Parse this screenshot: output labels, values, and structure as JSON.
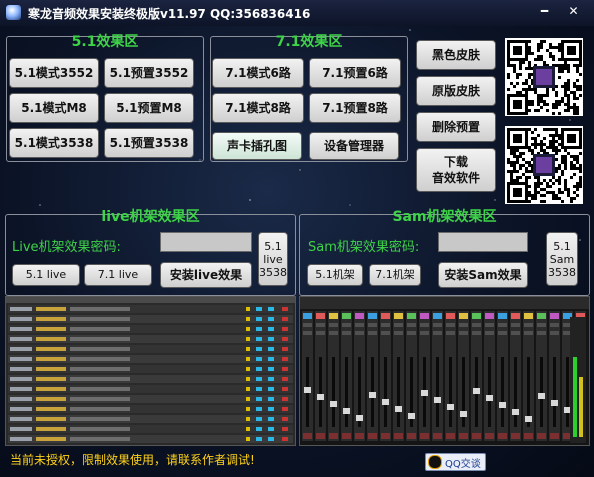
{
  "window": {
    "title": "寒龙音频效果安装终极版v11.97 QQ:356836416",
    "minimize_glyph": "━",
    "close_glyph": "✕"
  },
  "panel_51": {
    "title": "5.1效果区",
    "buttons": [
      "5.1模式3552",
      "5.1预置3552",
      "5.1模式M8",
      "5.1预置M8",
      "5.1模式3538",
      "5.1预置3538"
    ]
  },
  "panel_71": {
    "title": "7.1效果区",
    "buttons": [
      "7.1模式6路",
      "7.1预置6路",
      "7.1模式8路",
      "7.1预置8路"
    ],
    "jack_button": "声卡插孔图",
    "device_button": "设备管理器"
  },
  "right_buttons": {
    "black_skin": "黑色皮肤",
    "original_skin": "原版皮肤",
    "delete_preset": "删除预置",
    "download": "下载\n音效软件"
  },
  "live_panel": {
    "title": "live机架效果区",
    "password_label": "Live机架效果密码:",
    "password_value": "",
    "btn_51": "5.1 live",
    "btn_71": "7.1 live",
    "install": "安装live效果",
    "side_button": "5.1\nlive\n3538"
  },
  "sam_panel": {
    "title": "Sam机架效果区",
    "password_label": "Sam机架效果密码:",
    "password_value": "",
    "btn_51": "5.1机架",
    "btn_71": "7.1机架",
    "install": "安装Sam效果",
    "side_button": "5.1\nSam\n3538"
  },
  "status": {
    "text": "当前未授权，限制效果使用，请联系作者调试!",
    "qq_button": "QQ交谈"
  },
  "icons": [
    "app-icon",
    "qr-code-icon",
    "qq-penguin-icon"
  ],
  "colors": {
    "accent_green": "#3ed447",
    "status_yellow": "#ffd21a",
    "bg": "#0b1326"
  }
}
